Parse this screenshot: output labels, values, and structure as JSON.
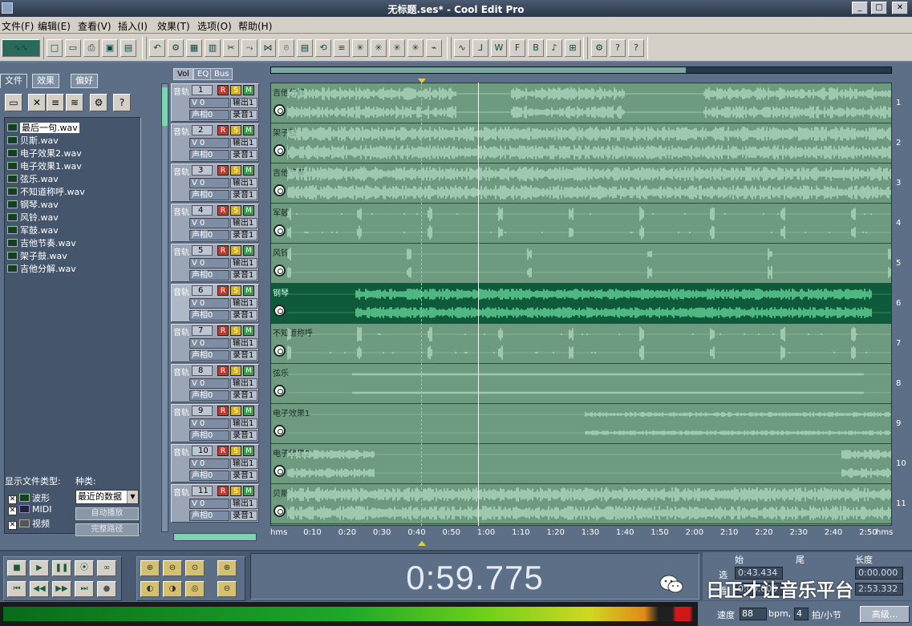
{
  "window": {
    "title": "无标题.ses* - Cool Edit Pro"
  },
  "menu": [
    "文件(F)",
    "编辑(E)",
    "查看(V)",
    "插入(I)",
    "效果(T)",
    "选项(O)",
    "帮助(H)"
  ],
  "left_panel": {
    "tabs": [
      "文件",
      "效果",
      "偏好"
    ],
    "files": [
      "最后一句.wav",
      "贝斯.wav",
      "电子效果2.wav",
      "电子效果1.wav",
      "弦乐.wav",
      "不知道称呼.wav",
      "钢琴.wav",
      "风铃.wav",
      "军鼓.wav",
      "吉他节奏.wav",
      "架子鼓.wav",
      "吉他分解.wav"
    ],
    "selected_file": "最后一句.wav",
    "file_type_label": "显示文件类型:",
    "category_label": "种类:",
    "file_types": [
      {
        "label": "波形",
        "checked": true
      },
      {
        "label": "MIDI",
        "checked": true
      },
      {
        "label": "视频",
        "checked": true
      }
    ],
    "category_value": "最近的数据",
    "auto_play": "自动播放",
    "full_path": "完整路径"
  },
  "track_controls": {
    "tabs": [
      "Vol",
      "EQ",
      "Bus"
    ],
    "track_label": "音轨",
    "vol": "V 0",
    "pan": "声相0",
    "out": "输出1",
    "rec": "录音1",
    "r": "R",
    "s": "S",
    "m": "M"
  },
  "tracks": [
    {
      "num": "1",
      "name": "吉他分解"
    },
    {
      "num": "2",
      "name": "架子鼓"
    },
    {
      "num": "3",
      "name": "吉他节奏"
    },
    {
      "num": "4",
      "name": "军鼓"
    },
    {
      "num": "5",
      "name": "风铃"
    },
    {
      "num": "6",
      "name": "钢琴"
    },
    {
      "num": "7",
      "name": "不知道称呼"
    },
    {
      "num": "8",
      "name": "弦乐"
    },
    {
      "num": "9",
      "name": "电子效果1"
    },
    {
      "num": "10",
      "name": "电子效果2"
    },
    {
      "num": "11",
      "name": "贝斯"
    }
  ],
  "selected_track": "6",
  "timeline": [
    "hms",
    "0:10",
    "0:20",
    "0:30",
    "0:40",
    "0:50",
    "1:00",
    "1:10",
    "1:20",
    "1:30",
    "1:40",
    "1:50",
    "2:00",
    "2:10",
    "2:20",
    "2:30",
    "2:40",
    "2:50",
    "hms"
  ],
  "time_display": "0:59.775",
  "selection": {
    "headers": [
      "始",
      "尾",
      "长度"
    ],
    "row1_label": "选",
    "row2_label": "看",
    "sel_begin": "0:43.434",
    "sel_length": "0:00.000",
    "view_begin": "0:00.000",
    "view_length": "2:53.332"
  },
  "tempo": {
    "label": "速度",
    "value": "88",
    "unit": "bpm,",
    "beats": "4",
    "beats_label": "拍/小节"
  },
  "advanced_button": "高级...",
  "watermark": "日正才让音乐平台",
  "colors": {
    "wave": "#bfe8d0",
    "selected_wave": "#7cf5b4",
    "track_bg": "#6e9a80",
    "selected_track_bg": "#0f5a3a"
  }
}
